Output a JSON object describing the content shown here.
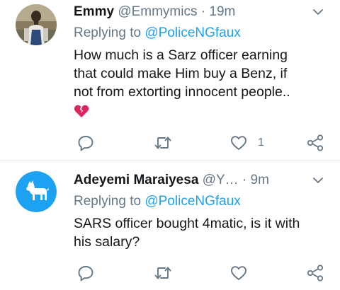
{
  "tweets": [
    {
      "name": "Emmy",
      "handle": "@Emmymics",
      "separator": "·",
      "time": "19m",
      "reply_prefix": "Replying to",
      "reply_to": "@PoliceNGfaux",
      "text_lines": [
        "How much is a Sarz officer earning",
        "that could make Him buy a Benz, if",
        "not from extorting innocent people.."
      ],
      "emoji": "broken-heart",
      "like_count": "1",
      "icons": [
        "reply-icon",
        "retweet-icon",
        "like-icon",
        "share-icon",
        "chevron-down-icon"
      ]
    },
    {
      "name": "Adeyemi Maraiyesa",
      "handle": "@Y…",
      "separator": "·",
      "time": "9m",
      "reply_prefix": "Replying to",
      "reply_to": "@PoliceNGfaux",
      "text_lines": [
        "SARS officer bought 4matic, is it with",
        "his salary?"
      ],
      "like_count": "",
      "icons": [
        "reply-icon",
        "retweet-icon",
        "like-icon",
        "share-icon",
        "chevron-down-icon"
      ]
    }
  ],
  "colors": {
    "text": "#14171a",
    "muted": "#657786",
    "link": "#1da1f2",
    "divider": "#e1e8ed",
    "default_avatar": "#1da1f2",
    "broken_heart": "#e0245e"
  }
}
